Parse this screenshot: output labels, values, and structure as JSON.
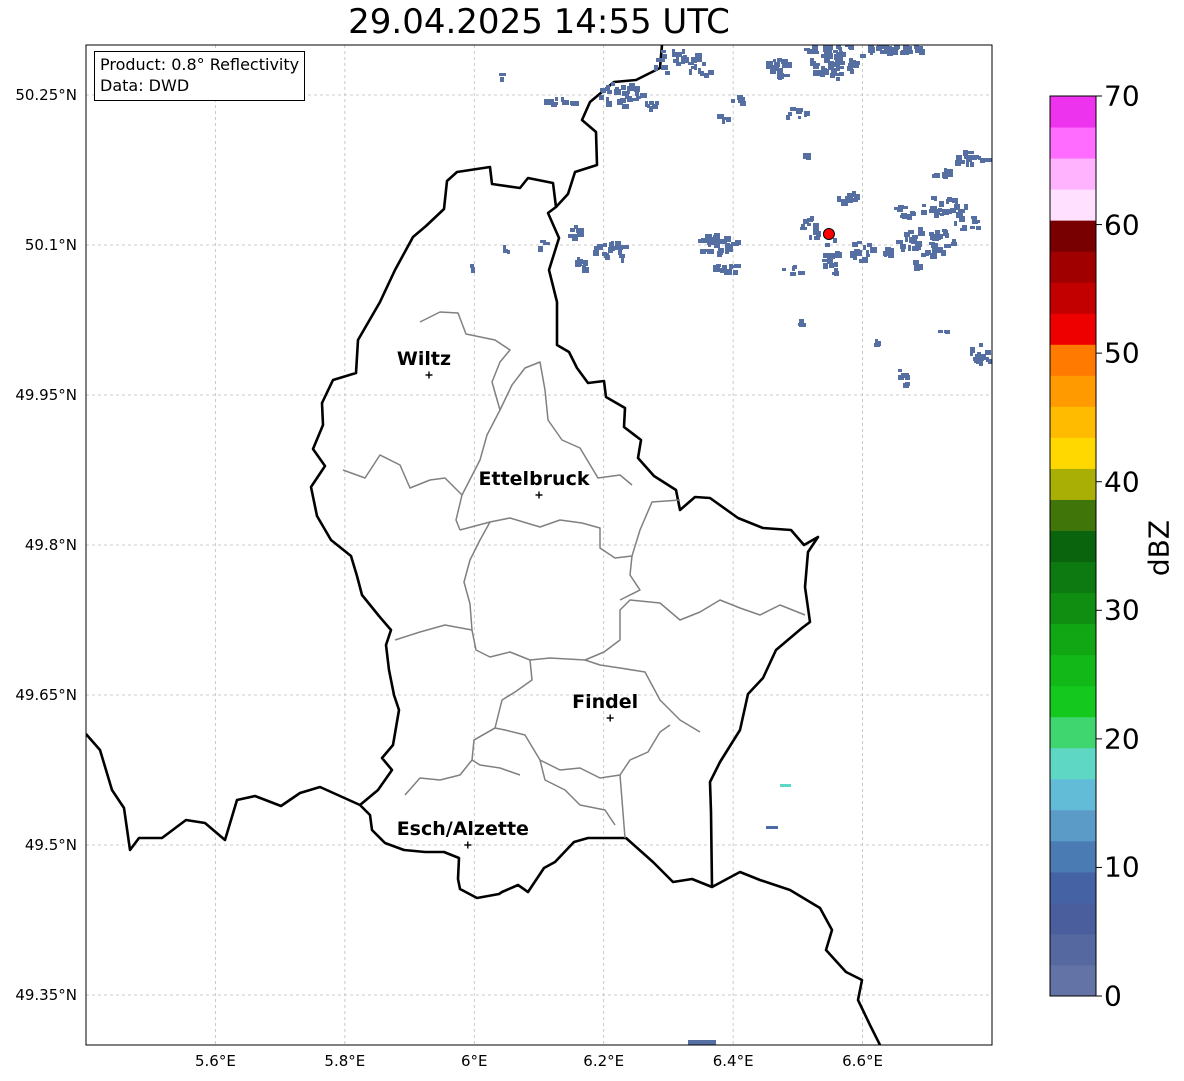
{
  "title": "29.04.2025 14:55 UTC",
  "info": {
    "product": "Product: 0.8° Reflectivity",
    "data": "Data: DWD"
  },
  "lat_ticks": [
    {
      "value": 50.25,
      "label": "50.25°N"
    },
    {
      "value": 50.1,
      "label": "50.1°N"
    },
    {
      "value": 49.95,
      "label": "49.95°N"
    },
    {
      "value": 49.8,
      "label": "49.8°N"
    },
    {
      "value": 49.65,
      "label": "49.65°N"
    },
    {
      "value": 49.5,
      "label": "49.5°N"
    },
    {
      "value": 49.35,
      "label": "49.35°N"
    }
  ],
  "lon_ticks": [
    {
      "value": 5.6,
      "label": "5.6°E"
    },
    {
      "value": 5.8,
      "label": "5.8°E"
    },
    {
      "value": 6.0,
      "label": "6°E"
    },
    {
      "value": 6.2,
      "label": "6.2°E"
    },
    {
      "value": 6.4,
      "label": "6.4°E"
    },
    {
      "value": 6.6,
      "label": "6.6°E"
    }
  ],
  "extent": {
    "lon_min": 5.4,
    "lon_max": 6.8,
    "lat_min": 49.3,
    "lat_max": 50.3
  },
  "cities": [
    {
      "name": "Wiltz",
      "lon": 5.93,
      "lat": 49.97
    },
    {
      "name": "Ettelbruck",
      "lon": 6.1,
      "lat": 49.85
    },
    {
      "name": "Findel",
      "lon": 6.21,
      "lat": 49.627
    },
    {
      "name": "Esch/Alzette",
      "lon": 5.99,
      "lat": 49.5
    }
  ],
  "radar_site": {
    "lon": 6.548,
    "lat": 50.111,
    "color": "#ff0000"
  },
  "colorbar": {
    "label": "dBZ",
    "min": 0,
    "max": 70,
    "ticks": [
      0,
      10,
      20,
      30,
      40,
      50,
      60,
      70
    ],
    "colors": [
      "#6473a5",
      "#5668a0",
      "#4a5e9d",
      "#4563a4",
      "#4a7cb3",
      "#5a9cc7",
      "#62bcd8",
      "#5ed8c4",
      "#3fd66f",
      "#14c81e",
      "#12b818",
      "#10a614",
      "#0f8e12",
      "#0c7a10",
      "#0a640e",
      "#3f7509",
      "#aaaf06",
      "#ffd800",
      "#ffbb00",
      "#ff9a00",
      "#ff7a00",
      "#ee0000",
      "#c20000",
      "#a10000",
      "#780000",
      "#ffe0ff",
      "#ffb3ff",
      "#ff6cff",
      "#ee33ee"
    ]
  },
  "echo_color": "#566fa3"
}
